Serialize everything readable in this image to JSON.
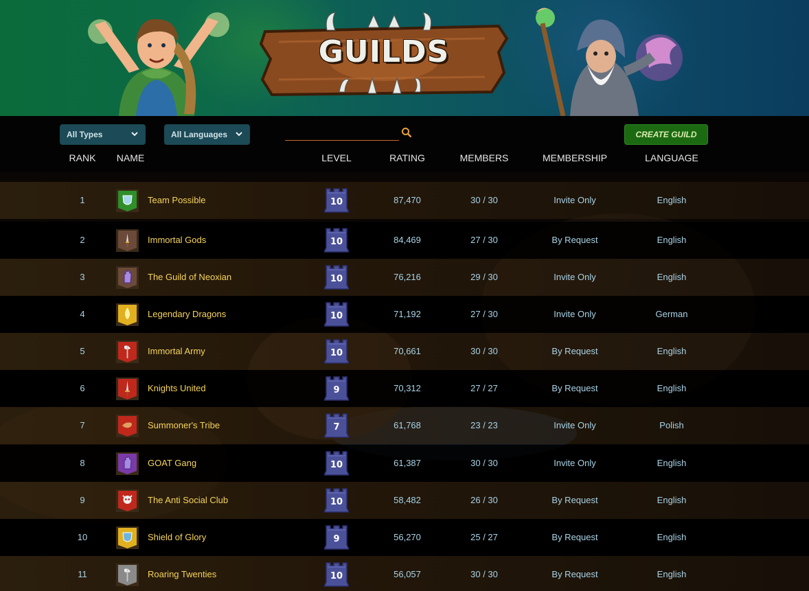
{
  "banner": {
    "title": "GUILDS"
  },
  "filters": {
    "type_selected": "All Types",
    "language_selected": "All Languages",
    "search_value": "",
    "search_placeholder": ""
  },
  "actions": {
    "create_guild_label": "CREATE GUILD"
  },
  "columns": {
    "rank": "RANK",
    "name": "NAME",
    "level": "LEVEL",
    "rating": "RATING",
    "members": "MEMBERS",
    "membership": "MEMBERSHIP",
    "language": "LANGUAGE"
  },
  "colors": {
    "accent_name": "#f6d55a",
    "text_value": "#a9d3e6",
    "create_button": "#1b6a12",
    "select_bg": "#1c4a56",
    "level_badge": "#4b5199"
  },
  "guilds": [
    {
      "rank": "1",
      "name": "Team Possible",
      "level": "10",
      "rating": "87,470",
      "members": "30 / 30",
      "membership": "Invite Only",
      "language": "English",
      "crest_icon": "green-shield-icon",
      "crest_color": "#2f8f2a"
    },
    {
      "rank": "2",
      "name": "Immortal Gods",
      "level": "10",
      "rating": "84,469",
      "members": "27 / 30",
      "membership": "By Request",
      "language": "English",
      "crest_icon": "dagger-icon",
      "crest_color": "#6b4a3a"
    },
    {
      "rank": "3",
      "name": "The Guild of Neoxian",
      "level": "10",
      "rating": "76,216",
      "members": "29 / 30",
      "membership": "Invite Only",
      "language": "English",
      "crest_icon": "purple-hand-icon",
      "crest_color": "#6b4a3a"
    },
    {
      "rank": "4",
      "name": "Legendary Dragons",
      "level": "10",
      "rating": "71,192",
      "members": "27 / 30",
      "membership": "Invite Only",
      "language": "German",
      "crest_icon": "flame-icon",
      "crest_color": "#e0b020"
    },
    {
      "rank": "5",
      "name": "Immortal Army",
      "level": "10",
      "rating": "70,661",
      "members": "30 / 30",
      "membership": "By Request",
      "language": "English",
      "crest_icon": "axe-icon",
      "crest_color": "#c0281c"
    },
    {
      "rank": "6",
      "name": "Knights United",
      "level": "9",
      "rating": "70,312",
      "members": "27 / 27",
      "membership": "By Request",
      "language": "English",
      "crest_icon": "sword-icon",
      "crest_color": "#c0281c"
    },
    {
      "rank": "7",
      "name": "Summoner's Tribe",
      "level": "7",
      "rating": "61,768",
      "members": "23 / 23",
      "membership": "Invite Only",
      "language": "Polish",
      "crest_icon": "bird-icon",
      "crest_color": "#c0281c"
    },
    {
      "rank": "8",
      "name": "GOAT Gang",
      "level": "10",
      "rating": "61,387",
      "members": "30 / 30",
      "membership": "Invite Only",
      "language": "English",
      "crest_icon": "purple-hand-icon",
      "crest_color": "#7a3aa8"
    },
    {
      "rank": "9",
      "name": "The Anti Social Club",
      "level": "10",
      "rating": "58,482",
      "members": "26 / 30",
      "membership": "By Request",
      "language": "English",
      "crest_icon": "skull-icon",
      "crest_color": "#c0281c"
    },
    {
      "rank": "10",
      "name": "Shield of Glory",
      "level": "9",
      "rating": "56,270",
      "members": "25 / 27",
      "membership": "By Request",
      "language": "English",
      "crest_icon": "blue-shield-icon",
      "crest_color": "#e0b020"
    },
    {
      "rank": "11",
      "name": "Roaring Twenties",
      "level": "10",
      "rating": "56,057",
      "members": "30 / 30",
      "membership": "By Request",
      "language": "English",
      "crest_icon": "axe-icon",
      "crest_color": "#8a8a8a"
    }
  ]
}
